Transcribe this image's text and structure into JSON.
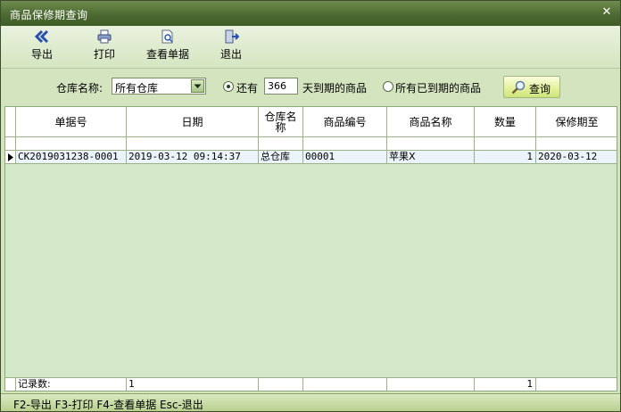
{
  "window": {
    "title": "商品保修期查询"
  },
  "toolbar": {
    "export_label": "导出",
    "print_label": "打印",
    "view_label": "查看单据",
    "exit_label": "退出"
  },
  "filter": {
    "warehouse_label": "仓库名称:",
    "warehouse_value": "所有仓库",
    "remaining_label": "还有",
    "days_value": "366",
    "days_suffix": "天到期的商品",
    "all_expired_label": "所有已到期的商品",
    "query_label": "查询"
  },
  "table": {
    "columns": [
      "单据号",
      "日期",
      "仓库名称",
      "商品编号",
      "商品名称",
      "数量",
      "保修期至"
    ],
    "rows": [
      [
        "CK2019031238-0001",
        "2019-03-12 09:14:37",
        "总仓库",
        "00001",
        "苹果X",
        "1",
        "2020-03-12"
      ]
    ],
    "footer": {
      "record_label": "记录数:",
      "record_count": "1",
      "quantity_total": "1"
    }
  },
  "status": {
    "text": "F2-导出 F3-打印 F4-查看单据 Esc-退出"
  },
  "colors": {
    "titlebar": "#4c6a31",
    "grid_bg": "#d3e8c9",
    "row_bg": "#ebf4fa"
  }
}
